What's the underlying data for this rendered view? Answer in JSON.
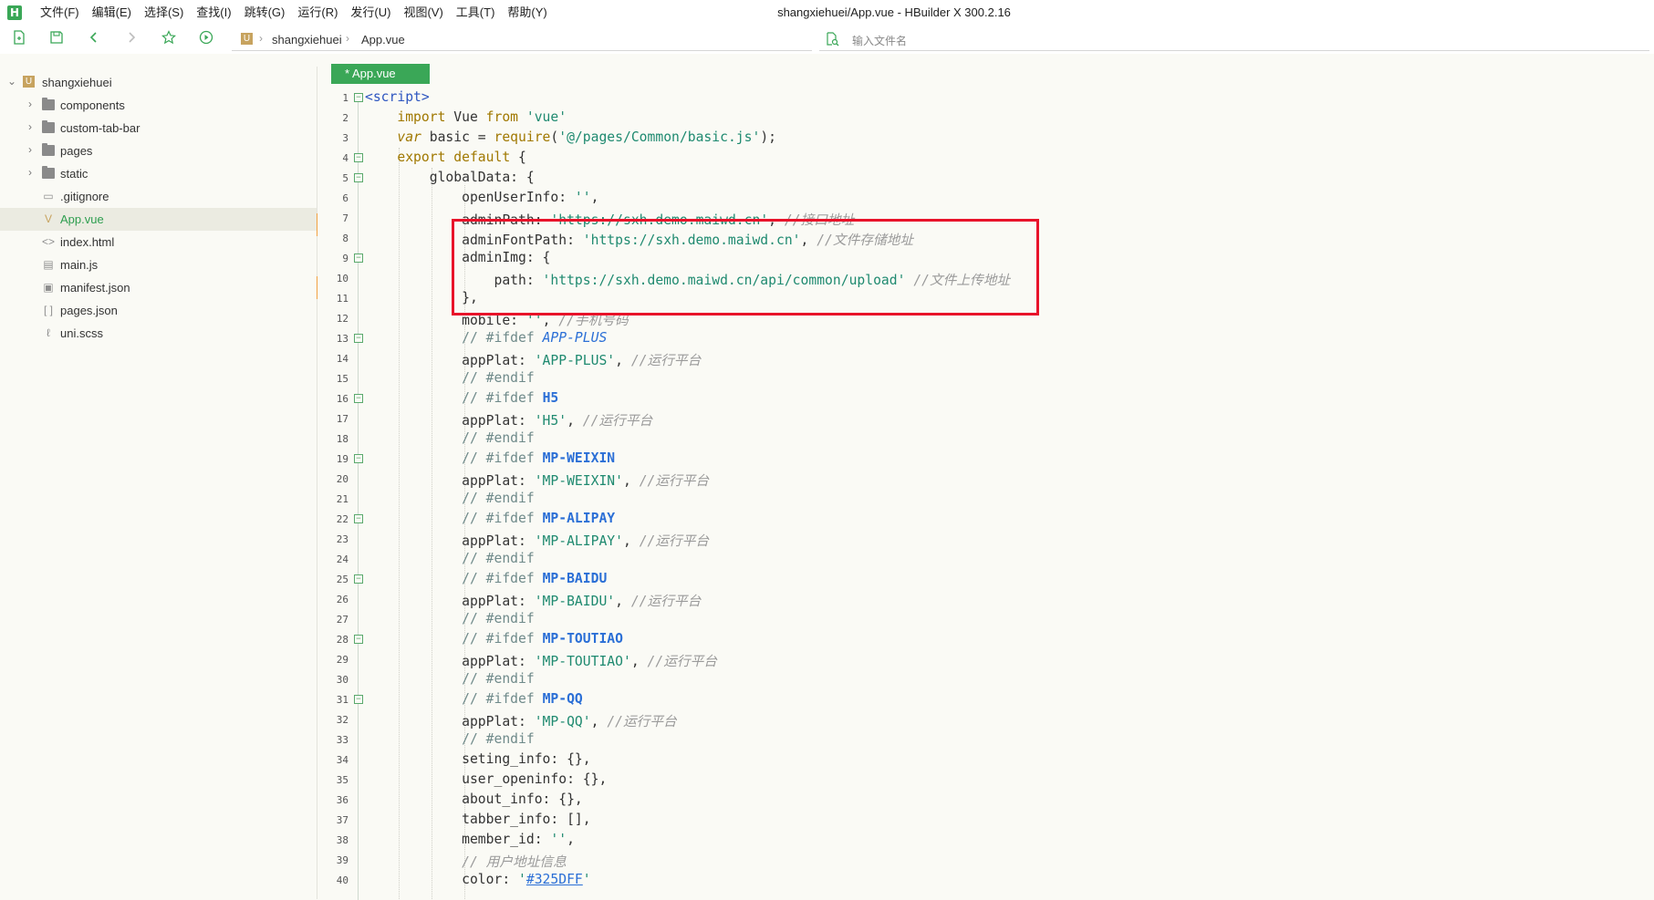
{
  "app": {
    "logo": "H",
    "title": "shangxiehuei/App.vue - HBuilder X 300.2.16"
  },
  "menu": [
    "文件(F)",
    "编辑(E)",
    "选择(S)",
    "查找(I)",
    "跳转(G)",
    "运行(R)",
    "发行(U)",
    "视图(V)",
    "工具(T)",
    "帮助(Y)"
  ],
  "toolbar": {
    "breadcrumb": [
      "shangxiehuei",
      "App.vue"
    ],
    "search_placeholder": "输入文件名",
    "icons": [
      "new-file-icon",
      "save-icon",
      "back-arrow-icon",
      "forward-arrow-icon",
      "star-icon",
      "run-icon"
    ]
  },
  "sidebar": {
    "project": "shangxiehuei",
    "items": [
      {
        "label": "components",
        "type": "folder"
      },
      {
        "label": "custom-tab-bar",
        "type": "folder"
      },
      {
        "label": "pages",
        "type": "folder"
      },
      {
        "label": "static",
        "type": "folder"
      },
      {
        "label": ".gitignore",
        "type": "file"
      },
      {
        "label": "App.vue",
        "type": "vue",
        "selected": true
      },
      {
        "label": "index.html",
        "type": "html"
      },
      {
        "label": "main.js",
        "type": "js"
      },
      {
        "label": "manifest.json",
        "type": "json"
      },
      {
        "label": "pages.json",
        "type": "json"
      },
      {
        "label": "uni.scss",
        "type": "scss"
      }
    ]
  },
  "editor": {
    "tab_label": "* App.vue",
    "lines": [
      {
        "n": "1",
        "fold": true
      },
      {
        "n": "2"
      },
      {
        "n": "3"
      },
      {
        "n": "4",
        "fold": true
      },
      {
        "n": "5",
        "fold": true
      },
      {
        "n": "6"
      },
      {
        "n": "7"
      },
      {
        "n": "8"
      },
      {
        "n": "9",
        "fold": true
      },
      {
        "n": "10"
      },
      {
        "n": "11"
      },
      {
        "n": "12"
      },
      {
        "n": "13",
        "fold": true
      },
      {
        "n": "14"
      },
      {
        "n": "15"
      },
      {
        "n": "16",
        "fold": true
      },
      {
        "n": "17"
      },
      {
        "n": "18"
      },
      {
        "n": "19",
        "fold": true
      },
      {
        "n": "20"
      },
      {
        "n": "21"
      },
      {
        "n": "22",
        "fold": true
      },
      {
        "n": "23"
      },
      {
        "n": "24"
      },
      {
        "n": "25",
        "fold": true
      },
      {
        "n": "26"
      },
      {
        "n": "27"
      },
      {
        "n": "28",
        "fold": true
      },
      {
        "n": "29"
      },
      {
        "n": "30"
      },
      {
        "n": "31",
        "fold": true
      },
      {
        "n": "32"
      },
      {
        "n": "33"
      },
      {
        "n": "34"
      },
      {
        "n": "35"
      },
      {
        "n": "36"
      },
      {
        "n": "37"
      },
      {
        "n": "38"
      },
      {
        "n": "39"
      },
      {
        "n": "40"
      }
    ],
    "code": {
      "l1": {
        "tag": "<script>"
      },
      "l2": {
        "kw": "import",
        "name": " Vue ",
        "from": "from",
        "str": "'vue'"
      },
      "l3": {
        "var": "var",
        "mid": " basic = ",
        "fn": "require",
        "open": "(",
        "str": "'@/pages/Common/basic.js'",
        "close": ");"
      },
      "l4": {
        "kw": "export default",
        "rest": " {"
      },
      "l5": {
        "text": "globalData: {"
      },
      "l6": {
        "key": "openUserInfo: ",
        "str": "''",
        "rest": ","
      },
      "l7": {
        "key": "adminPath: ",
        "str": "'https://sxh.demo.maiwd.cn'",
        "rest": ", ",
        "cmt": "//接口地址"
      },
      "l8": {
        "key": "adminFontPath: ",
        "str": "'https://sxh.demo.maiwd.cn'",
        "rest": ", ",
        "cmt": "//文件存储地址"
      },
      "l9": {
        "text": "adminImg: {"
      },
      "l10": {
        "key": "path: ",
        "str": "'https://sxh.demo.maiwd.cn/api/common/upload'",
        "rest": " ",
        "cmt": "//文件上传地址"
      },
      "l11": {
        "text": "},"
      },
      "l12": {
        "key": "mobile: ",
        "str": "''",
        "rest": ", ",
        "cmt": "//手机号码"
      },
      "l13": {
        "cmt": "// #ifdef ",
        "def": "APP-PLUS"
      },
      "l14": {
        "key": "appPlat: ",
        "str": "'APP-PLUS'",
        "rest": ", ",
        "cmt": "//运行平台"
      },
      "l15": {
        "cmt": "// #endif"
      },
      "l16": {
        "cmt": "// #ifdef ",
        "def": "H5"
      },
      "l17": {
        "key": "appPlat: ",
        "str": "'H5'",
        "rest": ", ",
        "cmt": "//运行平台"
      },
      "l18": {
        "cmt": "// #endif"
      },
      "l19": {
        "cmt": "// #ifdef ",
        "def": "MP-WEIXIN"
      },
      "l20": {
        "key": "appPlat: ",
        "str": "'MP-WEIXIN'",
        "rest": ", ",
        "cmt": "//运行平台"
      },
      "l21": {
        "cmt": "// #endif"
      },
      "l22": {
        "cmt": "// #ifdef ",
        "def": "MP-ALIPAY"
      },
      "l23": {
        "key": "appPlat: ",
        "str": "'MP-ALIPAY'",
        "rest": ", ",
        "cmt": "//运行平台"
      },
      "l24": {
        "cmt": "// #endif"
      },
      "l25": {
        "cmt": "// #ifdef ",
        "def": "MP-BAIDU"
      },
      "l26": {
        "key": "appPlat: ",
        "str": "'MP-BAIDU'",
        "rest": ", ",
        "cmt": "//运行平台"
      },
      "l27": {
        "cmt": "// #endif"
      },
      "l28": {
        "cmt": "// #ifdef ",
        "def": "MP-TOUTIAO"
      },
      "l29": {
        "key": "appPlat: ",
        "str": "'MP-TOUTIAO'",
        "rest": ", ",
        "cmt": "//运行平台"
      },
      "l30": {
        "cmt": "// #endif"
      },
      "l31": {
        "cmt": "// #ifdef ",
        "def": "MP-QQ"
      },
      "l32": {
        "key": "appPlat: ",
        "str": "'MP-QQ'",
        "rest": ", ",
        "cmt": "//运行平台"
      },
      "l33": {
        "cmt": "// #endif"
      },
      "l34": {
        "text": "seting_info: {},"
      },
      "l35": {
        "text": "user_openinfo: {},"
      },
      "l36": {
        "text": "about_info: {},"
      },
      "l37": {
        "text": "tabber_info: [],"
      },
      "l38": {
        "key": "member_id: ",
        "str": "''",
        "rest": ","
      },
      "l39": {
        "cmt": "// 用户地址信息"
      },
      "l40": {
        "key": "color: ",
        "q1": "'",
        "link": "#325DFF",
        "q2": "'"
      }
    }
  },
  "colors": {
    "accent": "#3aa757",
    "highlight_box": "#e8132a",
    "modified_marker": "#f2a141"
  }
}
